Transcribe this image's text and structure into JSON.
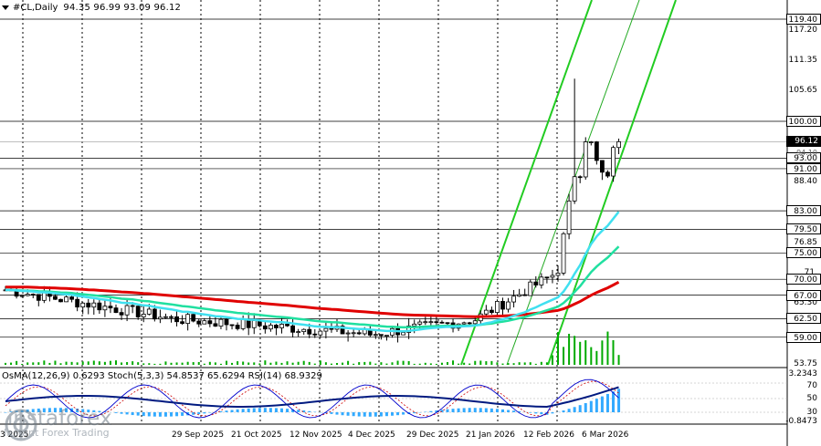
{
  "header": {
    "symbol": "#CL,Daily",
    "ohlc": "94.35 96.99 93.09 96.12"
  },
  "indicators": {
    "label": "OsMA(12,26,9) 0.6293  Stoch(5,3,3) 54.8537 65.6294  RSI(14) 68.9329"
  },
  "price_scale": {
    "labels": [
      "117.20",
      "111.35",
      "105.65",
      "88.40",
      "76.85",
      "71.",
      "65.30",
      "53.75"
    ],
    "levels": [
      "119.40",
      "100.00",
      "93.00",
      "91.00",
      "83.00",
      "79.50",
      "75.00",
      "70.00",
      "67.00",
      "62.50",
      "59.00"
    ],
    "current": "96.12",
    "hidden_label": "94.10"
  },
  "indicator_scale": {
    "labels": [
      "3.2343",
      "70",
      "50",
      "30",
      "-0.8473"
    ]
  },
  "time_axis": {
    "labels": [
      "3 2025",
      "29 Sep 2025",
      "21 Oct 2025",
      "12 Nov 2025",
      "4 Dec 2025",
      "29 Dec 2025",
      "21 Jan 2026",
      "12 Feb 2026",
      "6 Mar 2026"
    ]
  },
  "brand": {
    "name": "instaforex",
    "tagline": "Instant Forex Trading"
  },
  "colors": {
    "background": "#ffffff",
    "ema_slow": "#e00000",
    "ema_mid": "#20e0a0",
    "ema_fast": "#40e0f0",
    "channel": "#22cc22",
    "candle": "#000000",
    "volume": "#00aa00",
    "osma": "#33aaff",
    "stoch_main": "#0000cc",
    "stoch_signal": "#cc0000",
    "rsi": "#001a80"
  }
}
